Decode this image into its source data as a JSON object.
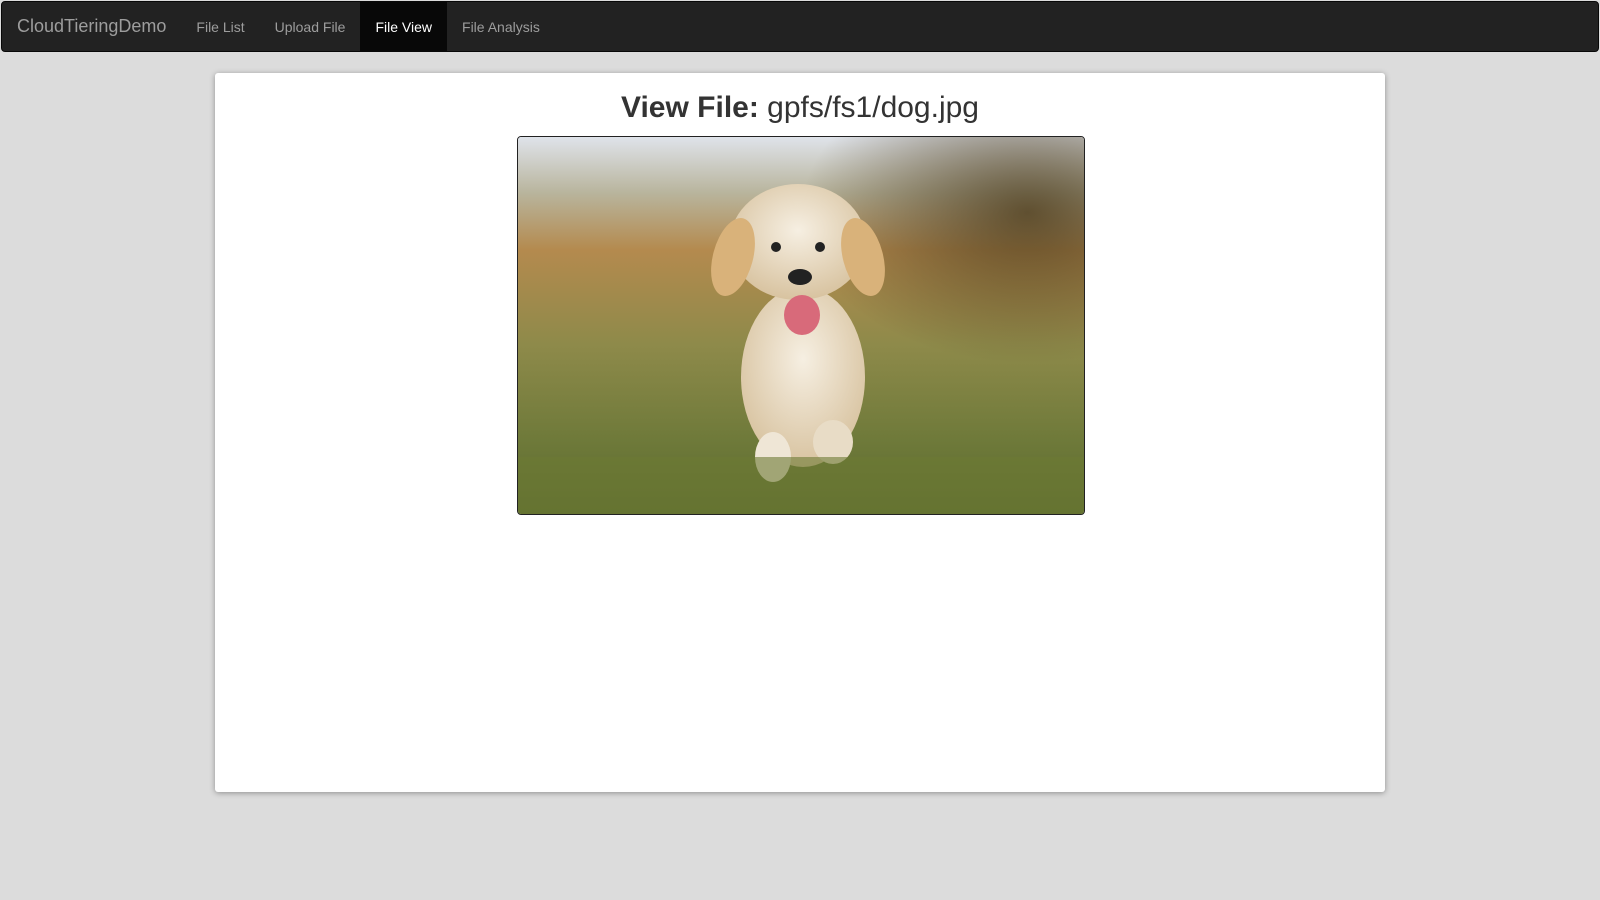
{
  "navbar": {
    "brand": "CloudTieringDemo",
    "items": [
      {
        "label": "File List",
        "active": false
      },
      {
        "label": "Upload File",
        "active": false
      },
      {
        "label": "File View",
        "active": true
      },
      {
        "label": "File Analysis",
        "active": false
      }
    ]
  },
  "main": {
    "title_label": "View File:",
    "file_path": "gpfs/fs1/dog.jpg",
    "image_alt": "dog.jpg"
  }
}
